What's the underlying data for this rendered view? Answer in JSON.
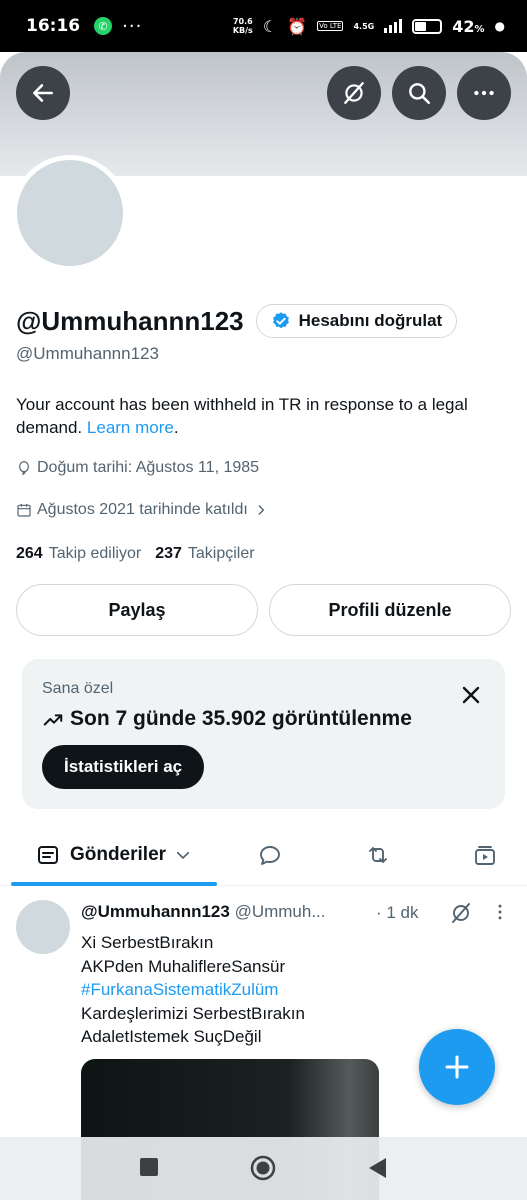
{
  "status_bar": {
    "time": "16:16",
    "dots": "···",
    "speed_value": "70.6",
    "speed_unit": "KB/s",
    "network": "4.5G",
    "lte": "Vo LTE",
    "battery": "42",
    "battery_unit": "%"
  },
  "profile": {
    "display_name": "@Ummuhannn123",
    "verify_label": "Hesabını doğrulat",
    "handle": "@Ummuhannn123",
    "bio": "Your account has been withheld in TR in response to a legal demand.",
    "bio_link": "Learn more",
    "bio_end": ".",
    "birthday": "Doğum tarihi: Ağustos 11, 1985",
    "joined": "Ağustos 2021 tarihinde katıldı",
    "following_count": "264",
    "following_label": "Takip ediliyor",
    "followers_count": "237",
    "followers_label": "Takipçiler"
  },
  "actions": {
    "share": "Paylaş",
    "edit": "Profili düzenle"
  },
  "insight_card": {
    "label": "Sana özel",
    "title": "Son 7 günde 35.902 görüntülenme",
    "button": "İstatistikleri aç"
  },
  "tabs": {
    "active_label": "Gönderiler"
  },
  "post": {
    "name": "@Ummuhannn123",
    "handle": "@Ummuh...",
    "time": "· 1 dk",
    "line1": "Xi SerbestBırakın",
    "line2": "AKPden MuhaliflereSansür",
    "hashtag": "#FurkanaSistematikZulüm",
    "line4": "Kardeşlerimizi SerbestBırakın",
    "line5": "AdaletIstemek SuçDeğil"
  },
  "colors": {
    "accent": "#1d9bf0",
    "text": "#0f1419",
    "muted": "#536471"
  },
  "icons": [
    "back-arrow-icon",
    "grok-icon",
    "search-icon",
    "more-icon",
    "verified-badge-icon",
    "balloon-icon",
    "calendar-icon",
    "chevron-right-icon",
    "trend-arrow-icon",
    "close-icon",
    "posts-icon",
    "chevron-down-icon",
    "reply-icon",
    "retweet-icon",
    "media-icon",
    "plus-icon"
  ]
}
